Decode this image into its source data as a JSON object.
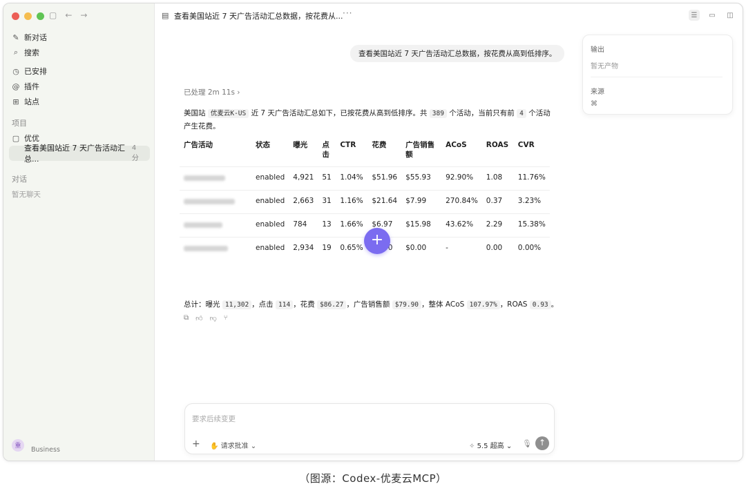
{
  "sidebar": {
    "nav": [
      {
        "icon": "edit-icon",
        "glyph": "✎",
        "label": "新对话"
      },
      {
        "icon": "search-icon",
        "glyph": "⌕",
        "label": "搜索"
      },
      {
        "icon": "clock-icon",
        "glyph": "◷",
        "label": "已安排"
      },
      {
        "icon": "plugin-icon",
        "glyph": "@",
        "label": "插件"
      },
      {
        "icon": "grid-icon",
        "glyph": "⊞",
        "label": "站点"
      }
    ],
    "projects_title": "项目",
    "project": {
      "icon": "folder-icon",
      "glyph": "▢",
      "label": "优优"
    },
    "chat": {
      "label": "查看美国站近 7 天广告活动汇总...",
      "time": "4 分"
    },
    "conversations_title": "对话",
    "no_chats": "暂无聊天",
    "profile": {
      "avatar": "重",
      "plan": "Business"
    }
  },
  "topbar": {
    "title": "查看美国站近 7 天广告活动汇总数据，按花费从...",
    "more": "···"
  },
  "user_message": "查看美国站近 7 天广告活动汇总数据，按花费从高到低排序。",
  "panel": {
    "output_label": "输出",
    "output_empty": "暂无产物",
    "source_label": "来源",
    "source_glyph": "⌘"
  },
  "processed": "已处理 2m 11s ›",
  "summary": {
    "p1": "美国站 ",
    "code1": "优麦云K-US",
    "p2": " 近 7 天广告活动汇总如下，已按花费从高到低排序。共 ",
    "code2": "389",
    "p3": " 个活动，当前只有前 ",
    "code3": "4",
    "p4": " 个活动产生花费。"
  },
  "table": {
    "headers": [
      "广告活动",
      "状态",
      "曝光",
      "点击",
      "CTR",
      "花费",
      "广告销售额",
      "ACoS",
      "ROAS",
      "CVR"
    ],
    "rows": [
      {
        "campaign": "",
        "status": "enabled",
        "impressions": "4,921",
        "clicks": "51",
        "ctr": "1.04%",
        "spend": "$51.96",
        "sales": "$55.93",
        "acos": "92.90%",
        "roas": "1.08",
        "cvr": "11.76%"
      },
      {
        "campaign": "",
        "status": "enabled",
        "impressions": "2,663",
        "clicks": "31",
        "ctr": "1.16%",
        "spend": "$21.64",
        "sales": "$7.99",
        "acos": "270.84%",
        "roas": "0.37",
        "cvr": "3.23%"
      },
      {
        "campaign": "",
        "status": "enabled",
        "impressions": "784",
        "clicks": "13",
        "ctr": "1.66%",
        "spend": "$6.97",
        "sales": "$15.98",
        "acos": "43.62%",
        "roas": "2.29",
        "cvr": "15.38%"
      },
      {
        "campaign": "",
        "status": "enabled",
        "impressions": "2,934",
        "clicks": "19",
        "ctr": "0.65%",
        "spend": "$5.70",
        "sales": "$0.00",
        "acos": "-",
        "roas": "0.00",
        "cvr": "0.00%"
      }
    ]
  },
  "total": {
    "t1": "总计：曝光 ",
    "c1": "11,302",
    "t2": "，点击 ",
    "c2": "114",
    "t3": "，花费 ",
    "c3": "$86.27",
    "t4": "，广告销售额 ",
    "c4": "$79.90",
    "t5": "，整体 ACoS ",
    "c5": "107.97%",
    "t6": "，ROAS ",
    "c6": "0.93",
    "t7": "。"
  },
  "composer": {
    "placeholder": "要求后续变更",
    "approval": "✋ 请求批准 ⌄",
    "model": "5.5 超高 ⌄"
  },
  "caption": "（图源：Codex-优麦云MCP）"
}
